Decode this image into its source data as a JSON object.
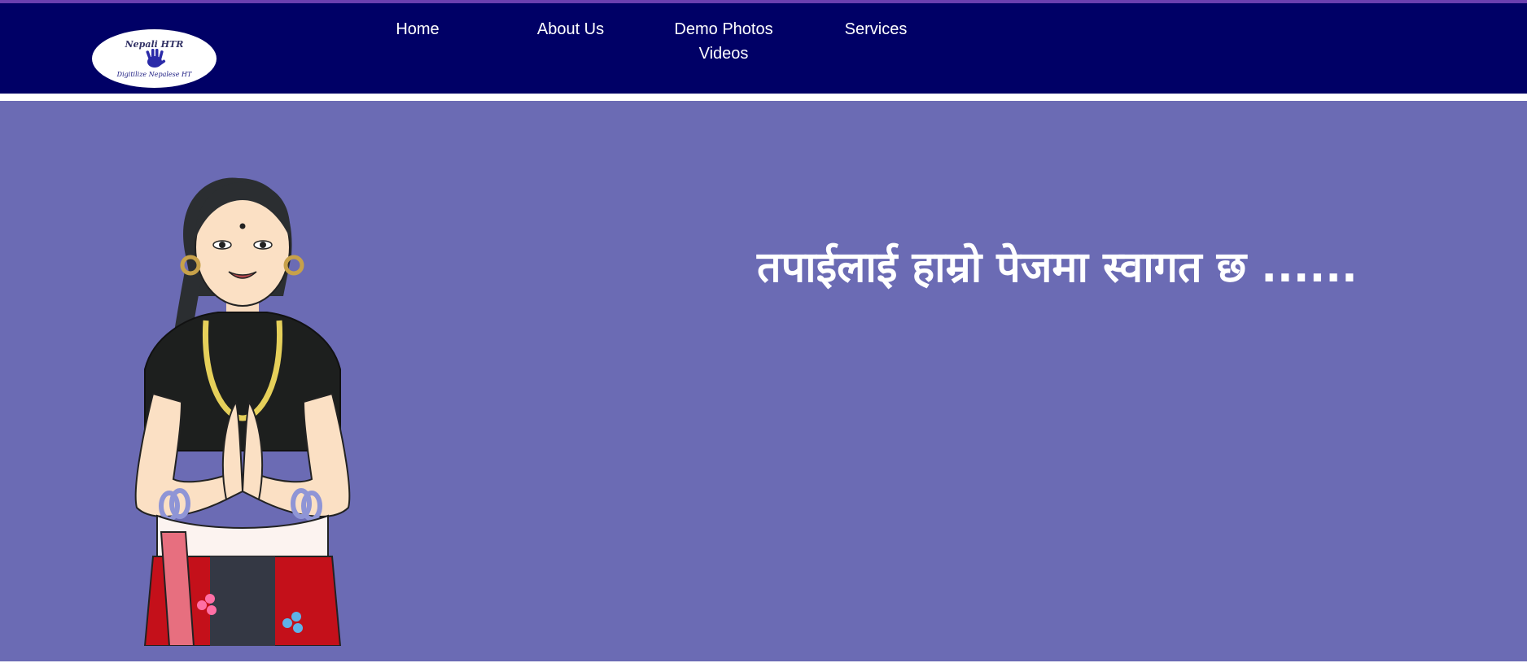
{
  "logo": {
    "title": "Nepali HTR",
    "subtitle": "Digitilize Nepalese HT",
    "icon": "hand-icon"
  },
  "nav": {
    "home": "Home",
    "about": "About Us",
    "demo_line1": "Demo Photos",
    "demo_line2": "Videos",
    "services": "Services"
  },
  "hero": {
    "title": "तपाईलाई हाम्रो पेजमा स्वागत छ ......",
    "illustration": "namaste-girl-illustration"
  },
  "colors": {
    "nav_background": "#000066",
    "hero_background": "#6b6bb4",
    "top_border": "#6a3fb0",
    "text": "#ffffff"
  }
}
